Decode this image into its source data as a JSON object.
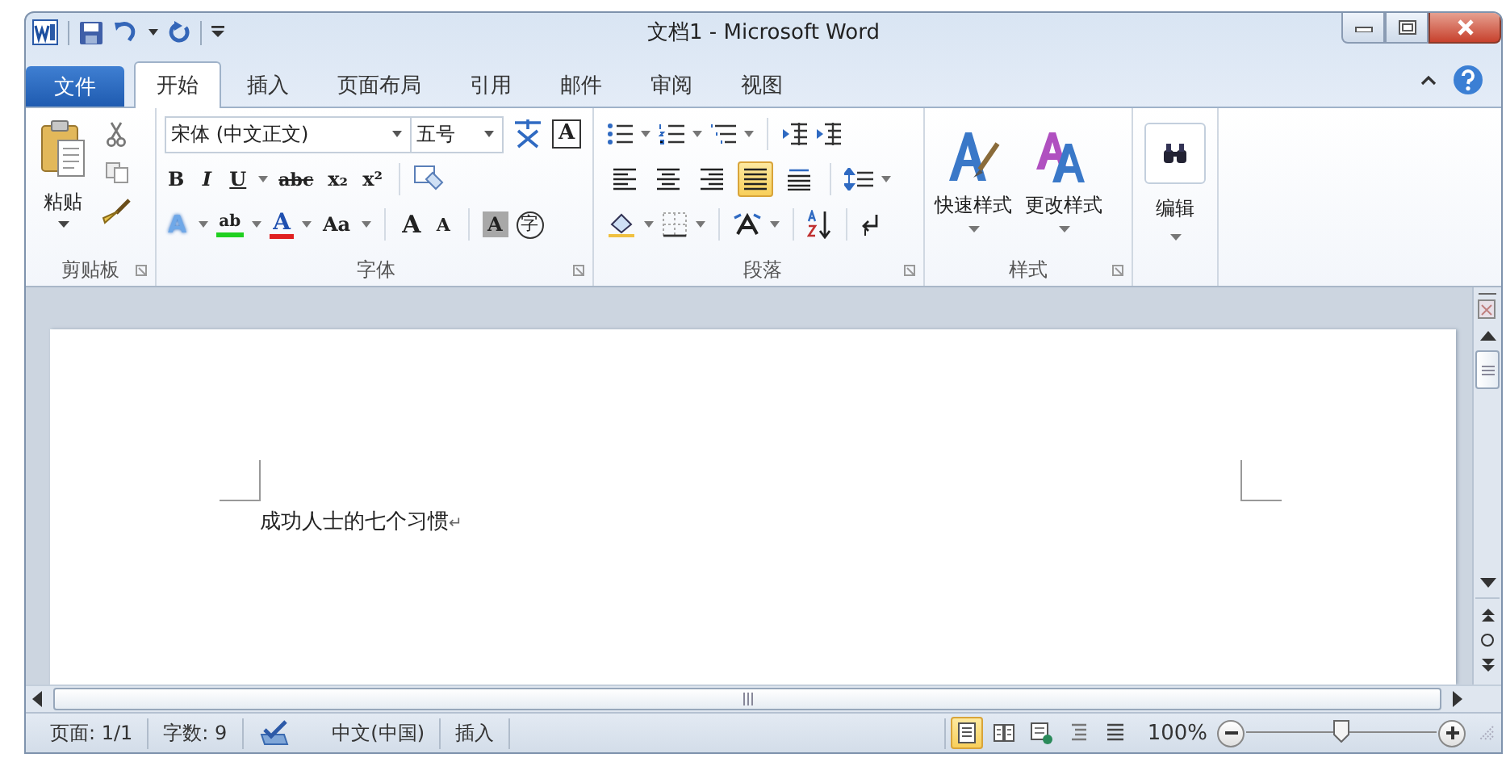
{
  "window": {
    "title": "文档1 - Microsoft Word"
  },
  "file_tab": {
    "label": "文件"
  },
  "tabs": [
    {
      "label": "开始",
      "selected": true
    },
    {
      "label": "插入",
      "selected": false
    },
    {
      "label": "页面布局",
      "selected": false
    },
    {
      "label": "引用",
      "selected": false
    },
    {
      "label": "邮件",
      "selected": false
    },
    {
      "label": "审阅",
      "selected": false
    },
    {
      "label": "视图",
      "selected": false
    }
  ],
  "ribbon": {
    "clipboard": {
      "label": "剪贴板",
      "paste": "粘贴"
    },
    "font": {
      "label": "字体",
      "font_name": "宋体 (中文正文)",
      "font_size": "五号",
      "border_char": "A",
      "format_buttons": [
        {
          "label": "B",
          "kind": "bold"
        },
        {
          "label": "I",
          "kind": "italic"
        },
        {
          "label": "U",
          "kind": "underline"
        },
        {
          "label": "abc",
          "kind": "strike"
        },
        {
          "label": "x₂",
          "kind": "plain"
        },
        {
          "label": "x²",
          "kind": "plain"
        }
      ],
      "effect_buttons": [
        {
          "label": "A",
          "kind": "glow"
        },
        {
          "label": "ab",
          "kind": "highlight"
        },
        {
          "label": "A",
          "kind": "fontcolor"
        },
        {
          "label": "Aa",
          "kind": "case"
        }
      ],
      "size_buttons": [
        "A",
        "A"
      ],
      "shading_char": "A",
      "enclose_char": "字"
    },
    "paragraph": {
      "label": "段落",
      "alignment_buttons": [
        {
          "selected": false
        },
        {
          "selected": false
        },
        {
          "selected": false
        },
        {
          "selected": true
        },
        {
          "selected": false
        }
      ]
    },
    "styles": {
      "label": "样式",
      "buttons": [
        "快速样式",
        "更改样式"
      ]
    },
    "editing": {
      "label": "编辑"
    }
  },
  "document": {
    "text": "成功人士的七个习惯",
    "paragraph_mark": "↵"
  },
  "status_bar": {
    "page": "页面: 1/1",
    "words": "字数: 9",
    "language": "中文(中国)",
    "mode": "插入",
    "view_buttons": [
      {
        "selected": true
      },
      {
        "selected": false
      },
      {
        "selected": false
      },
      {
        "selected": false
      },
      {
        "selected": false
      }
    ],
    "zoom": "100%",
    "zoom_slider": {
      "level": 0.5
    }
  }
}
